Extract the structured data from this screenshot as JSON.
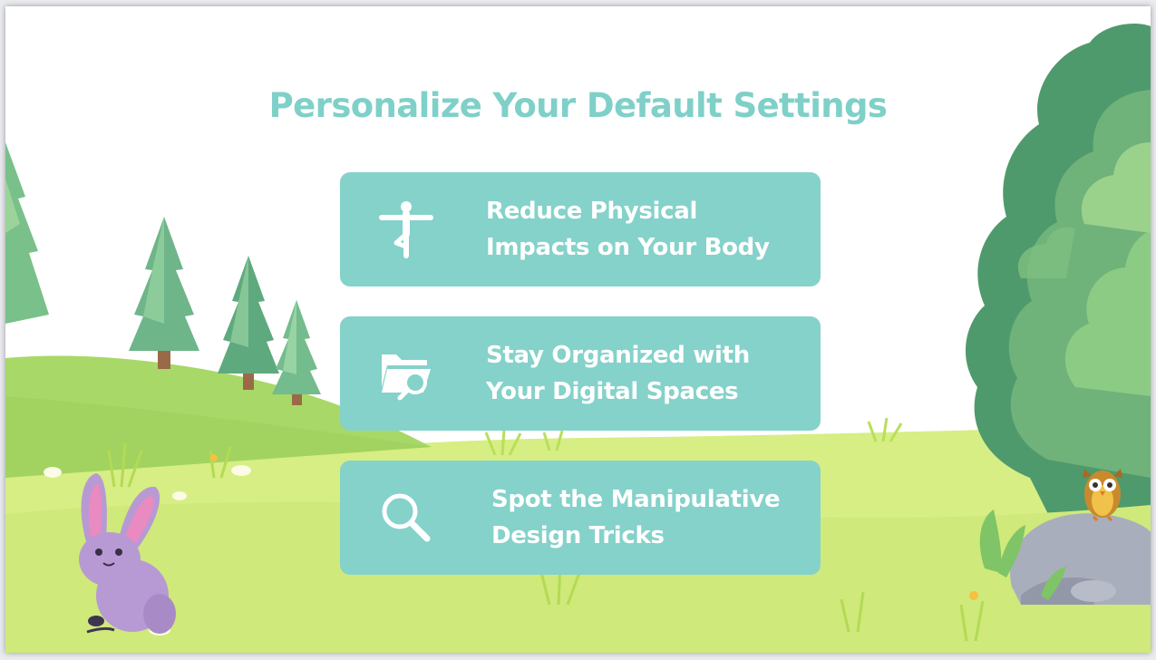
{
  "slide": {
    "title": "Personalize Your Default Settings",
    "cards": [
      {
        "lines": [
          "Reduce Physical",
          "Impacts on Your Body"
        ],
        "icon": "yoga-pose-icon"
      },
      {
        "lines": [
          "Stay Organized with",
          "Your Digital Spaces"
        ],
        "icon": "folder-search-icon"
      },
      {
        "lines": [
          "Spot the Manipulative",
          "Design Tricks"
        ],
        "icon": "magnifier-icon"
      }
    ]
  },
  "colors": {
    "accent": "#84d2ca",
    "title": "#7fd0c8",
    "grass": "#d4ec7c",
    "hill": "#a5d863",
    "tree_dark": "#4f9d70",
    "tree_light": "#8fcf8a"
  }
}
